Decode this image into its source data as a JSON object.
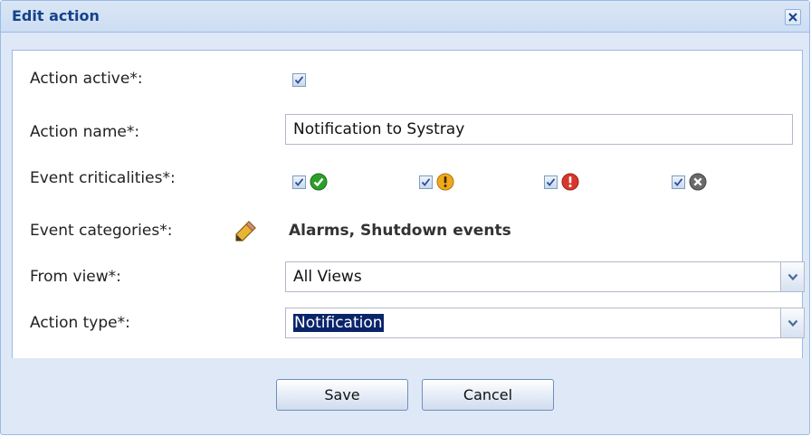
{
  "dialog": {
    "title": "Edit action"
  },
  "form": {
    "action_active_label": "Action active*:",
    "action_active_checked": true,
    "action_name_label": "Action name*:",
    "action_name_value": "Notification to Systray",
    "event_criticalities_label": "Event criticalities*:",
    "criticalities": [
      {
        "name": "ok",
        "checked": true,
        "icon": "check-circle-icon",
        "color": "#2e9e2a"
      },
      {
        "name": "warning",
        "checked": true,
        "icon": "warning-circle-icon",
        "color": "#f0a81c"
      },
      {
        "name": "error",
        "checked": true,
        "icon": "error-circle-icon",
        "color": "#d7382b"
      },
      {
        "name": "unknown",
        "checked": true,
        "icon": "x-circle-icon",
        "color": "#6a6a6a"
      }
    ],
    "event_categories_label": "Event categories*:",
    "event_categories_value": "Alarms, Shutdown events",
    "from_view_label": "From view*:",
    "from_view_value": "All Views",
    "action_type_label": "Action type*:",
    "action_type_value": "Notification"
  },
  "buttons": {
    "save": "Save",
    "cancel": "Cancel"
  }
}
